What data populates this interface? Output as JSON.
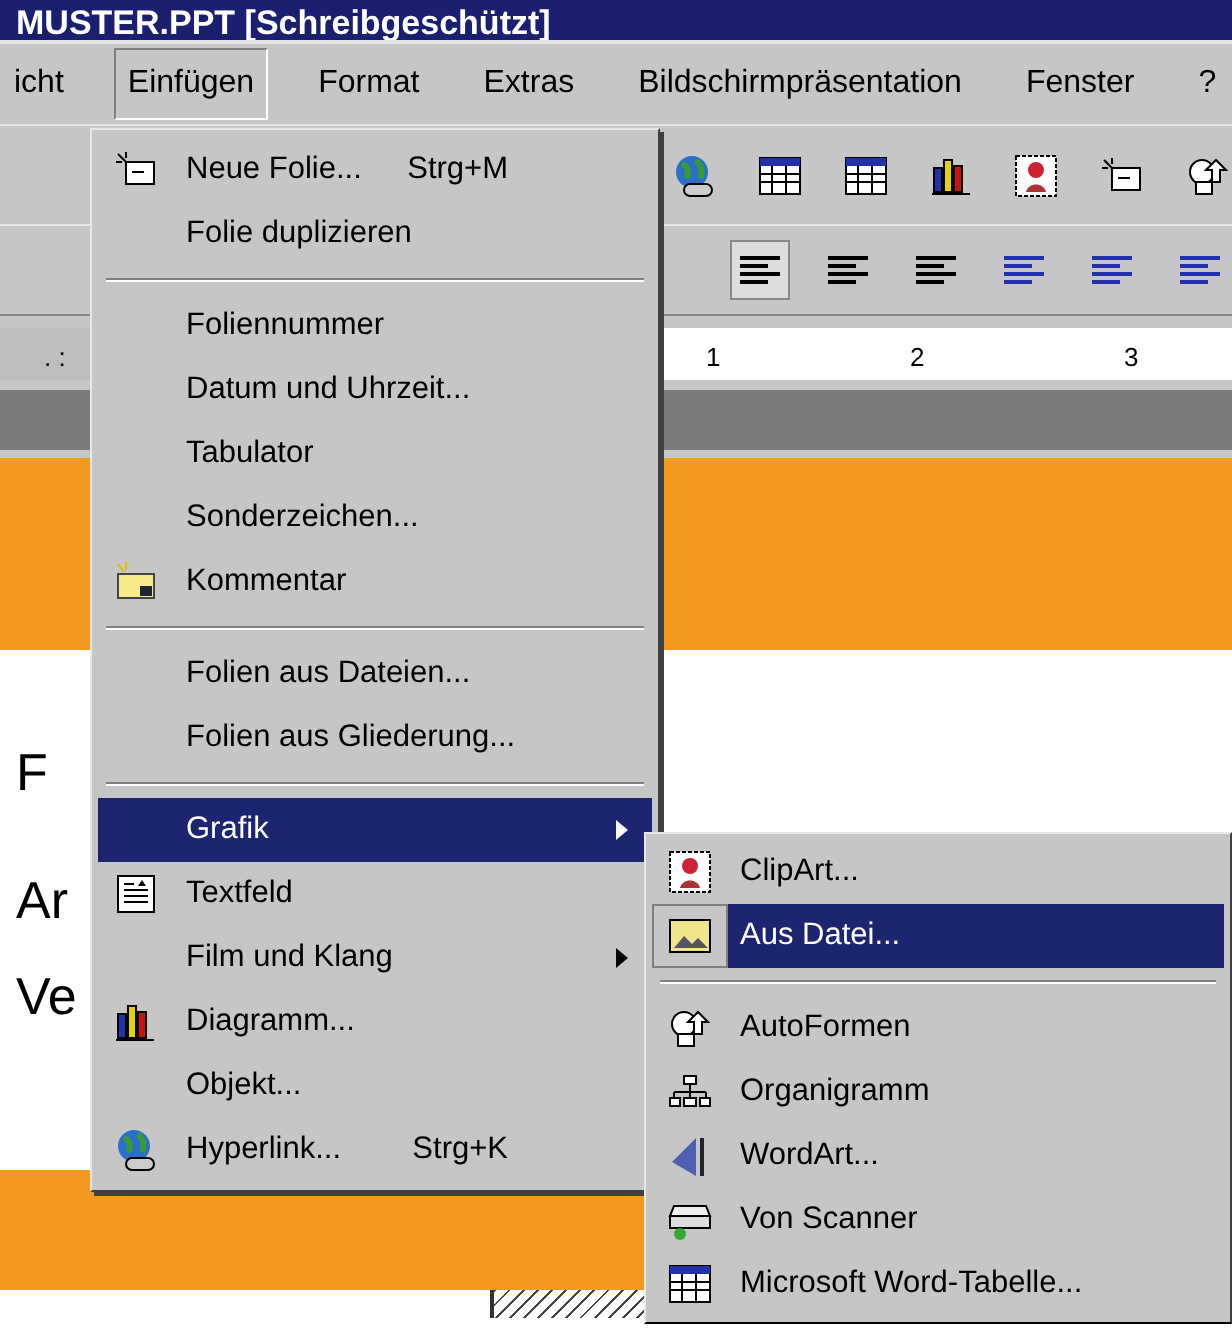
{
  "window": {
    "title": "MUSTER.PPT [Schreibgeschützt]"
  },
  "menu_bar": [
    {
      "label": "icht",
      "selected": false
    },
    {
      "label": "Einfügen",
      "selected": true
    },
    {
      "label": "Format",
      "selected": false
    },
    {
      "label": "Extras",
      "selected": false
    },
    {
      "label": "Bildschirmpräsentation",
      "selected": false
    },
    {
      "label": "Fenster",
      "selected": false
    },
    {
      "label": "?",
      "selected": false
    }
  ],
  "ruler": {
    "labels": [
      ". :",
      "1",
      "2",
      "3"
    ]
  },
  "slide": {
    "texts": [
      "F",
      "Ar",
      "Ve"
    ]
  },
  "insert_menu": [
    {
      "kind": "item",
      "label": "Neue Folie...",
      "shortcut": "Strg+M",
      "submenu": false,
      "selected": false
    },
    {
      "kind": "item",
      "label": "Folie duplizieren",
      "submenu": false,
      "selected": false
    },
    {
      "kind": "separator"
    },
    {
      "kind": "item",
      "label": "Foliennummer",
      "submenu": false,
      "selected": false
    },
    {
      "kind": "item",
      "label": "Datum und Uhrzeit...",
      "submenu": false,
      "selected": false
    },
    {
      "kind": "item",
      "label": "Tabulator",
      "submenu": false,
      "selected": false
    },
    {
      "kind": "item",
      "label": "Sonderzeichen...",
      "submenu": false,
      "selected": false
    },
    {
      "kind": "item",
      "label": "Kommentar",
      "submenu": false,
      "selected": false
    },
    {
      "kind": "separator"
    },
    {
      "kind": "item",
      "label": "Folien aus Dateien...",
      "submenu": false,
      "selected": false
    },
    {
      "kind": "item",
      "label": "Folien aus Gliederung...",
      "submenu": false,
      "selected": false
    },
    {
      "kind": "separator"
    },
    {
      "kind": "item",
      "label": "Grafik",
      "submenu": true,
      "selected": true
    },
    {
      "kind": "item",
      "label": "Textfeld",
      "submenu": false,
      "selected": false
    },
    {
      "kind": "item",
      "label": "Film und Klang",
      "submenu": true,
      "selected": false
    },
    {
      "kind": "item",
      "label": "Diagramm...",
      "submenu": false,
      "selected": false
    },
    {
      "kind": "item",
      "label": "Objekt...",
      "submenu": false,
      "selected": false
    },
    {
      "kind": "item",
      "label": "Hyperlink...",
      "shortcut": "Strg+K",
      "submenu": false,
      "selected": false
    }
  ],
  "graphic_submenu": [
    {
      "kind": "item",
      "label": "ClipArt...",
      "selected": false
    },
    {
      "kind": "item",
      "label": "Aus Datei...",
      "selected": true
    },
    {
      "kind": "separator"
    },
    {
      "kind": "item",
      "label": "AutoFormen",
      "selected": false
    },
    {
      "kind": "item",
      "label": "Organigramm",
      "selected": false
    },
    {
      "kind": "item",
      "label": "WordArt...",
      "selected": false
    },
    {
      "kind": "item",
      "label": "Von Scanner",
      "selected": false
    },
    {
      "kind": "item",
      "label": "Microsoft Word-Tabelle...",
      "selected": false
    }
  ]
}
